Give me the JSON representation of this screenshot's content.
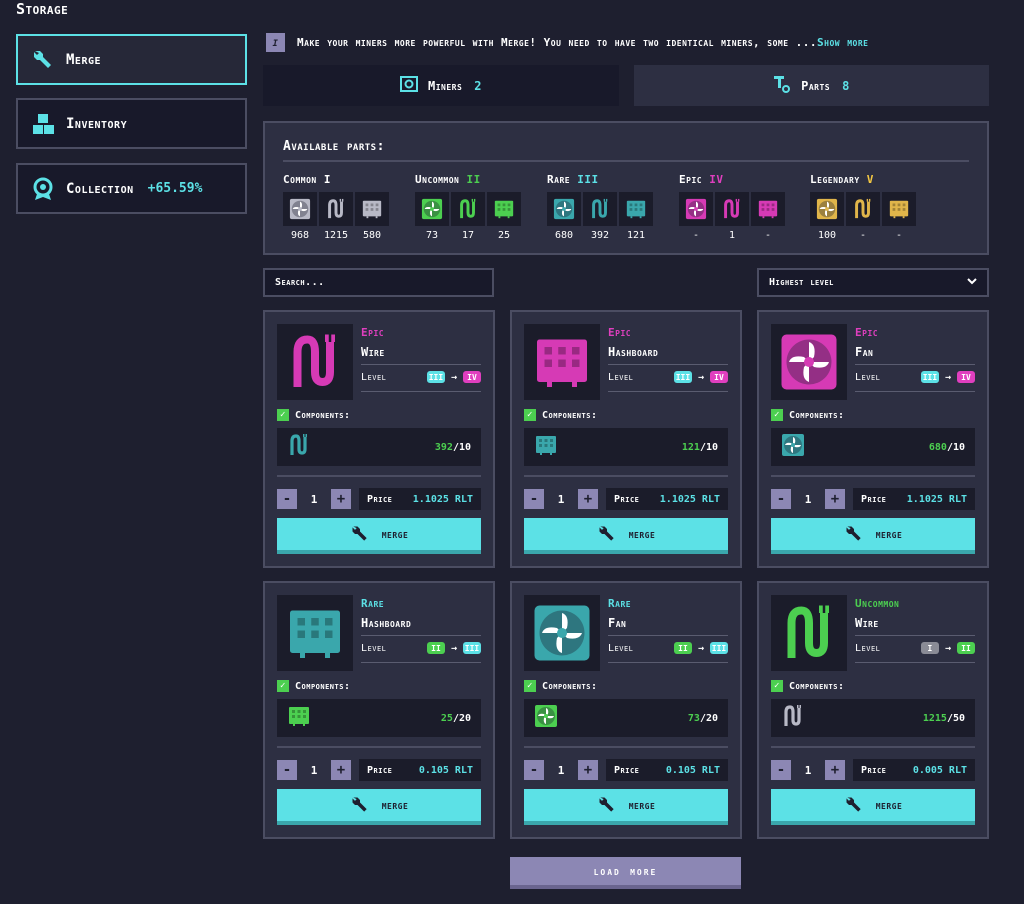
{
  "sidebar": {
    "title": "Storage",
    "items": [
      {
        "label": "Merge",
        "icon": "wrench-icon"
      },
      {
        "label": "Inventory",
        "icon": "boxes-icon"
      },
      {
        "label": "Collection",
        "icon": "medal-icon",
        "extra": "+65.59%"
      }
    ]
  },
  "info": {
    "text": "Make your miners more powerful with Merge! You need to have two identical miners, some ...",
    "more": "Show more"
  },
  "tabs": [
    {
      "label": "Miners",
      "count": "2"
    },
    {
      "label": "Parts",
      "count": "8"
    }
  ],
  "parts_panel": {
    "title": "Available parts:",
    "groups": [
      {
        "name": "Common",
        "tier": "I",
        "color": "#ffffff",
        "counts": [
          "968",
          "1215",
          "580"
        ]
      },
      {
        "name": "Uncommon",
        "tier": "II",
        "color": "#4ccf50",
        "counts": [
          "73",
          "17",
          "25"
        ]
      },
      {
        "name": "Rare",
        "tier": "III",
        "color": "#5ce1e6",
        "counts": [
          "680",
          "392",
          "121"
        ]
      },
      {
        "name": "Epic",
        "tier": "IV",
        "color": "#e03fbf",
        "counts": [
          "-",
          "1",
          "-"
        ]
      },
      {
        "name": "Legendary",
        "tier": "V",
        "color": "#f5c842",
        "counts": [
          "100",
          "-",
          "-"
        ]
      }
    ]
  },
  "search": {
    "placeholder": "Search..."
  },
  "sort": {
    "selected": "Highest level"
  },
  "cards": [
    {
      "rarity": "Epic",
      "name": "Wire",
      "level_label": "Level",
      "from": "III",
      "to": "IV",
      "components_label": "Components:",
      "have": "392",
      "need": "/10",
      "qty": "1",
      "price_label": "Price",
      "price": "1.1025 RLT",
      "button": "merge"
    },
    {
      "rarity": "Epic",
      "name": "Hashboard",
      "level_label": "Level",
      "from": "III",
      "to": "IV",
      "components_label": "Components:",
      "have": "121",
      "need": "/10",
      "qty": "1",
      "price_label": "Price",
      "price": "1.1025 RLT",
      "button": "merge"
    },
    {
      "rarity": "Epic",
      "name": "Fan",
      "level_label": "Level",
      "from": "III",
      "to": "IV",
      "components_label": "Components:",
      "have": "680",
      "need": "/10",
      "qty": "1",
      "price_label": "Price",
      "price": "1.1025 RLT",
      "button": "merge"
    },
    {
      "rarity": "Rare",
      "name": "Hashboard",
      "level_label": "Level",
      "from": "II",
      "to": "III",
      "components_label": "Components:",
      "have": "25",
      "need": "/20",
      "qty": "1",
      "price_label": "Price",
      "price": "0.105 RLT",
      "button": "merge"
    },
    {
      "rarity": "Rare",
      "name": "Fan",
      "level_label": "Level",
      "from": "II",
      "to": "III",
      "components_label": "Components:",
      "have": "73",
      "need": "/20",
      "qty": "1",
      "price_label": "Price",
      "price": "0.105 RLT",
      "button": "merge"
    },
    {
      "rarity": "Uncommon",
      "name": "Wire",
      "level_label": "Level",
      "from": "I",
      "to": "II",
      "components_label": "Components:",
      "have": "1215",
      "need": "/50",
      "qty": "1",
      "price_label": "Price",
      "price": "0.005 RLT",
      "button": "merge"
    }
  ],
  "load_more": "load more",
  "colors": {
    "accent": "#5ce1e6",
    "epic": "#e03fbf",
    "rare": "#5ce1e6",
    "uncommon": "#4ccf50",
    "legendary": "#f5c842",
    "panel": "#2d2f42",
    "bg": "#1e1f2f"
  }
}
